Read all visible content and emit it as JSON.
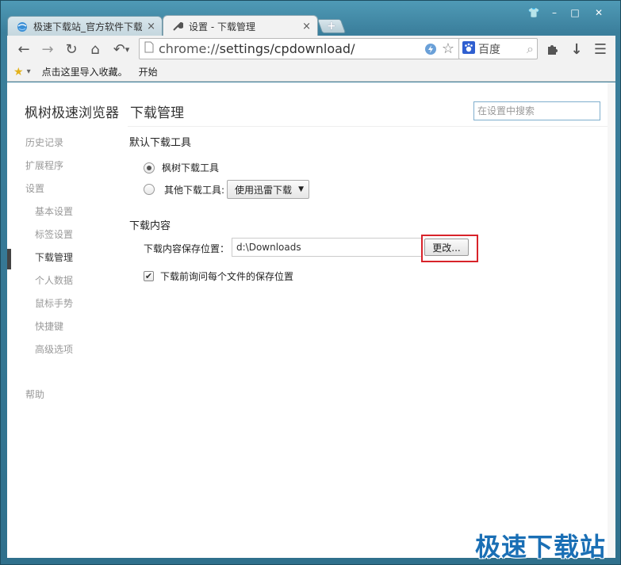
{
  "window": {
    "controls": {
      "skin": "👕",
      "minimize": "–",
      "maximize": "□",
      "close": "✕"
    }
  },
  "tabs": [
    {
      "title": "极速下载站_官方软件下载",
      "close": "×",
      "active": false,
      "icon": "ie-globe-icon"
    },
    {
      "title": "设置 - 下载管理",
      "close": "×",
      "active": true,
      "icon": "wrench-icon"
    }
  ],
  "toolbar": {
    "back": "←",
    "forward": "→",
    "reload": "↻",
    "home": "⌂",
    "undo": "↶",
    "undo_menu": "▾",
    "url_scheme": "chrome://",
    "url_path": "settings/cpdownload/",
    "search_engine": "百度",
    "search_icon": "⌕",
    "extension_icon": "puzzle-icon",
    "download_icon": "↓",
    "menu_icon": "☰"
  },
  "bookmarks": {
    "star": "★",
    "arrow": "▾",
    "import_text": "点击这里导入收藏。",
    "start_text": "开始"
  },
  "content": {
    "brand": "枫树极速浏览器",
    "page_title": "下载管理",
    "search_placeholder": "在设置中搜索",
    "nav": [
      {
        "label": "历史记录",
        "sub": false,
        "active": false
      },
      {
        "label": "扩展程序",
        "sub": false,
        "active": false
      },
      {
        "label": "设置",
        "sub": false,
        "active": false
      },
      {
        "label": "基本设置",
        "sub": true,
        "active": false
      },
      {
        "label": "标签设置",
        "sub": true,
        "active": false
      },
      {
        "label": "下载管理",
        "sub": true,
        "active": true
      },
      {
        "label": "个人数据",
        "sub": true,
        "active": false
      },
      {
        "label": "鼠标手势",
        "sub": true,
        "active": false
      },
      {
        "label": "快捷键",
        "sub": true,
        "active": false
      },
      {
        "label": "高级选项",
        "sub": true,
        "active": false
      }
    ],
    "nav_help": "帮助",
    "default_tool": {
      "heading": "默认下载工具",
      "option_builtin": "枫树下载工具",
      "option_other": "其他下载工具:",
      "selected": "builtin",
      "other_select_value": "使用迅雷下载",
      "caret": "▼"
    },
    "download_content": {
      "heading": "下载内容",
      "location_label": "下载内容保存位置：",
      "location_value": "d:\\Downloads",
      "change_button": "更改...",
      "ask_label": "下载前询问每个文件的保存位置",
      "ask_checked": true,
      "check_mark": "✔"
    },
    "highlight_color": "#d8232a"
  },
  "watermark": "极速下载站"
}
